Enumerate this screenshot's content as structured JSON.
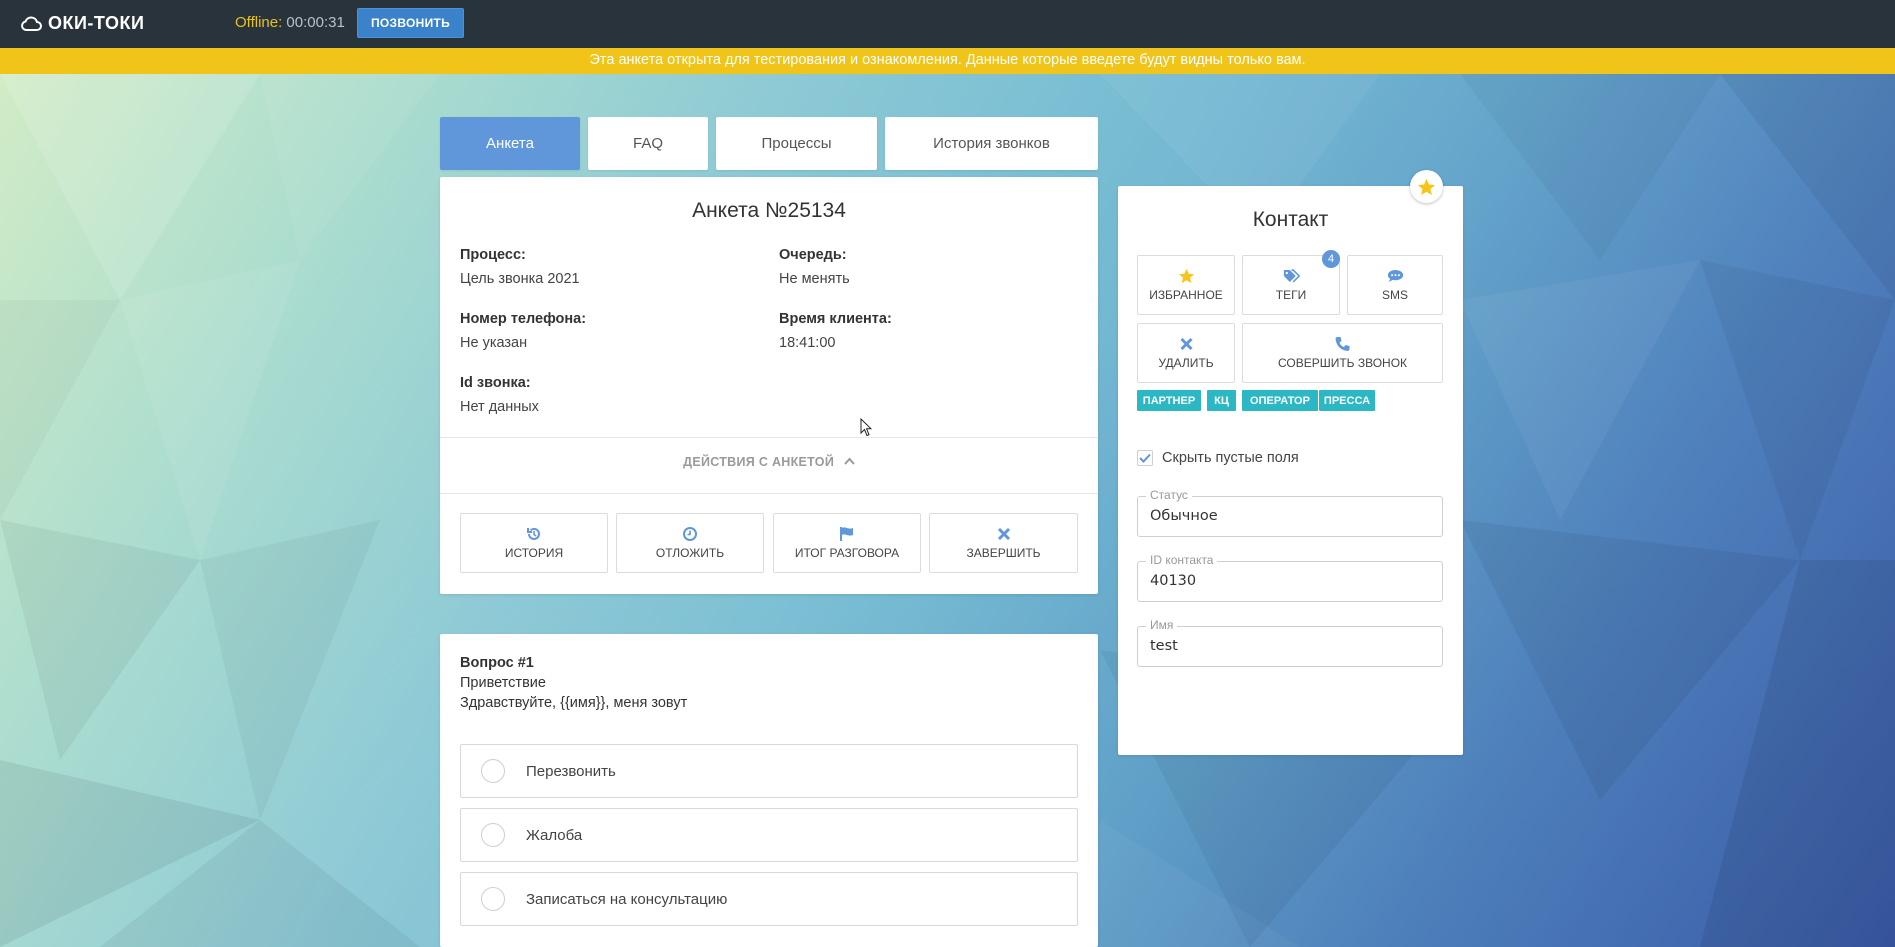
{
  "topbar": {
    "logo_text": "ОКИ-ТОКИ",
    "status_label": "Offline:",
    "status_time": "00:00:31",
    "call_button": "ПОЗВОНИТЬ"
  },
  "notice": "Эта анкета открыта для тестирования и ознакомления. Данные которые введете будут видны только вам.",
  "tabs": [
    {
      "label": "Анкета",
      "active": true
    },
    {
      "label": "FAQ",
      "active": false
    },
    {
      "label": "Процессы",
      "active": false
    },
    {
      "label": "История звонков",
      "active": false
    }
  ],
  "form": {
    "title": "Анкета №25134",
    "fields": {
      "process_label": "Процесс:",
      "process_value": "Цель звонка 2021",
      "queue_label": "Очередь:",
      "queue_value": "Не менять",
      "phone_label": "Номер телефона:",
      "phone_value": "Не указан",
      "client_time_label": "Время клиента:",
      "client_time_value": "18:41:00",
      "call_id_label": "Id звонка:",
      "call_id_value": "Нет данных"
    },
    "actions_toggle": "ДЕЙСТВИЯ С АНКЕТОЙ",
    "actions": [
      {
        "label": "ИСТОРИЯ",
        "icon": "history-icon"
      },
      {
        "label": "ОТЛОЖИТЬ",
        "icon": "clock-icon"
      },
      {
        "label": "ИТОГ РАЗГОВОРА",
        "icon": "flag-icon"
      },
      {
        "label": "ЗАВЕРШИТЬ",
        "icon": "close-icon"
      }
    ]
  },
  "question": {
    "title": "Вопрос #1",
    "subtitle": "Приветствие",
    "text": "Здравствуйте, {{имя}}, меня зовут",
    "options": [
      "Перезвонить",
      "Жалоба",
      "Записаться на консультацию"
    ]
  },
  "contact": {
    "title": "Контакт",
    "buttons": {
      "favorite": "ИЗБРАННОЕ",
      "tags": "ТЕГИ",
      "tags_count": "4",
      "sms": "SMS",
      "delete": "УДАЛИТЬ",
      "make_call": "СОВЕРШИТЬ ЗВОНОК"
    },
    "tags": [
      "ПАРТНЕР",
      "КЦ",
      "ОПЕРАТОР",
      "ПРЕССА"
    ],
    "hide_empty_label": "Скрыть пустые поля",
    "hide_empty_checked": true,
    "fields": {
      "status_label": "Статус",
      "status_value": "Обычное",
      "id_label": "ID контакта",
      "id_value": "40130",
      "name_label": "Имя",
      "name_value": "test"
    }
  },
  "colors": {
    "topbar": "#29333c",
    "notice": "#f0c419",
    "accent": "#5f97da",
    "tag": "#2bb8c4",
    "star": "#f5c518"
  }
}
